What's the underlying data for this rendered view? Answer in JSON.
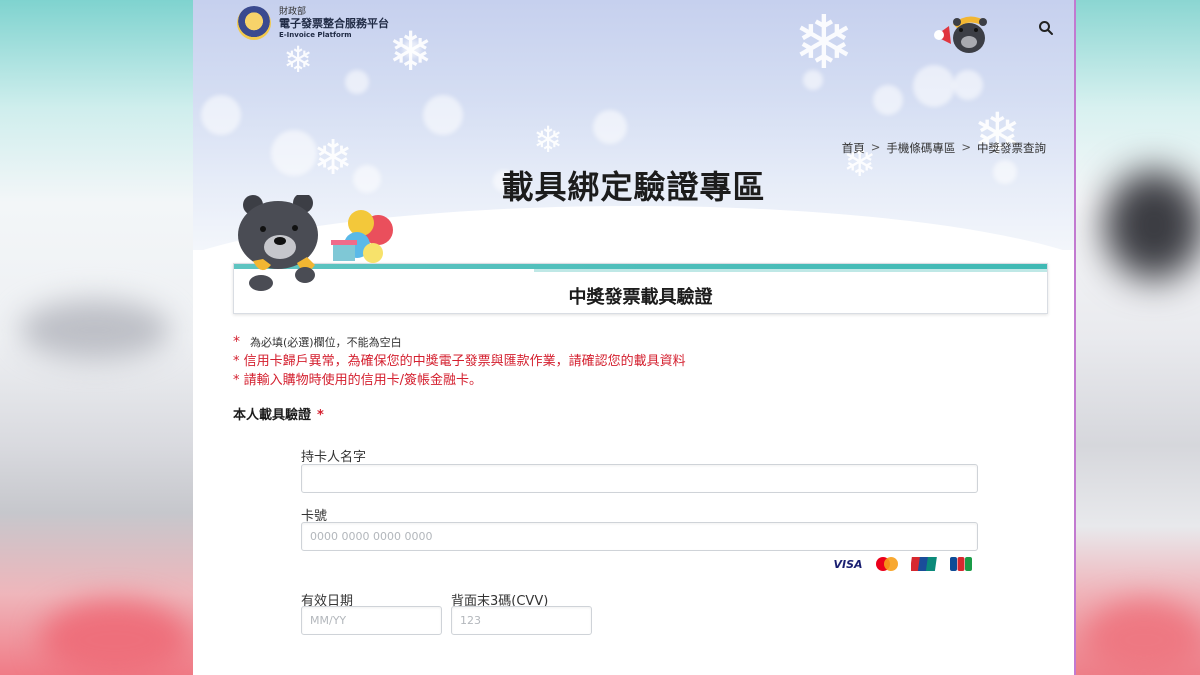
{
  "header": {
    "brand_top": "財政部",
    "brand_main": "電子發票整合服務平台",
    "brand_sub": "E-Invoice Platform"
  },
  "breadcrumb": {
    "items": [
      "首頁",
      "手機條碼專區",
      "中獎發票查詢"
    ],
    "separator": ">"
  },
  "page": {
    "title": "載具綁定驗證專區",
    "section_title": "中獎發票載具驗證"
  },
  "notes": {
    "required_star": "*",
    "required_note": "為必填(必選)欄位，不能為空白",
    "line1": "* 信用卡歸戶異常，為確保您的中獎電子發票與匯款作業，請確認您的載具資料",
    "line2": "* 請輸入購物時使用的信用卡/簽帳金融卡。"
  },
  "form": {
    "section_label": "本人載具驗證",
    "section_star": "*",
    "cardholder_label": "持卡人名字",
    "cardholder_value": "",
    "card_number_label": "卡號",
    "card_number_placeholder": "0000 0000 0000 0000",
    "expiry_label": "有效日期",
    "expiry_placeholder": "MM/YY",
    "cvv_label": "背面末3碼(CVV)",
    "cvv_placeholder": "123"
  },
  "card_brands": [
    "VISA",
    "MasterCard",
    "UnionPay",
    "JCB"
  ],
  "colors": {
    "required_red": "#d4202f",
    "accent_teal": "#3fb9b4",
    "hero_blue": "#c6d0ee"
  }
}
